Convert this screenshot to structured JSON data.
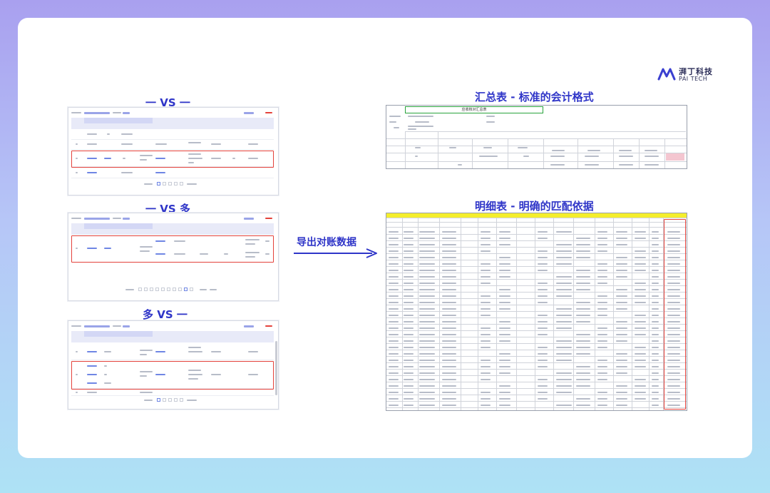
{
  "brand": {
    "name_zh": "湃丁科技",
    "name_en": "PAI TECH"
  },
  "sections": {
    "one_to_one": "一 VS 一",
    "one_to_many": "一 VS 多",
    "many_to_one": "多 VS 一",
    "summary_title": "汇总表 - 标准的会计格式",
    "detail_title": "明细表 - 明确的匹配依据"
  },
  "arrow": {
    "label": "导出对账数据"
  },
  "summary_sheet": {
    "title": "应收核对汇总表"
  },
  "colors": {
    "accent": "#2f35c8",
    "highlight": "#e4423b",
    "sheet_header": "#f4ee2c"
  }
}
